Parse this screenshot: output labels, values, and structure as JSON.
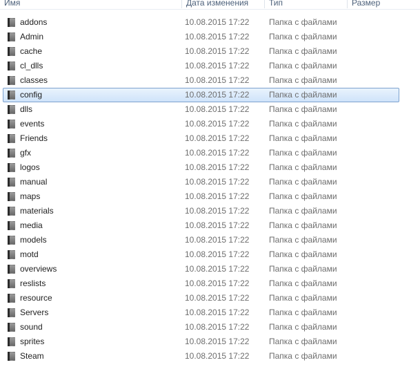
{
  "columns": {
    "name": "Имя",
    "date": "Дата изменения",
    "type": "Тип",
    "size": "Размер"
  },
  "selected_index": 5,
  "files": [
    {
      "name": "addons",
      "date": "10.08.2015 17:22",
      "type": "Папка с файлами"
    },
    {
      "name": "Admin",
      "date": "10.08.2015 17:22",
      "type": "Папка с файлами"
    },
    {
      "name": "cache",
      "date": "10.08.2015 17:22",
      "type": "Папка с файлами"
    },
    {
      "name": "cl_dlls",
      "date": "10.08.2015 17:22",
      "type": "Папка с файлами"
    },
    {
      "name": "classes",
      "date": "10.08.2015 17:22",
      "type": "Папка с файлами"
    },
    {
      "name": "config",
      "date": "10.08.2015 17:22",
      "type": "Папка с файлами"
    },
    {
      "name": "dlls",
      "date": "10.08.2015 17:22",
      "type": "Папка с файлами"
    },
    {
      "name": "events",
      "date": "10.08.2015 17:22",
      "type": "Папка с файлами"
    },
    {
      "name": "Friends",
      "date": "10.08.2015 17:22",
      "type": "Папка с файлами"
    },
    {
      "name": "gfx",
      "date": "10.08.2015 17:22",
      "type": "Папка с файлами"
    },
    {
      "name": "logos",
      "date": "10.08.2015 17:22",
      "type": "Папка с файлами"
    },
    {
      "name": "manual",
      "date": "10.08.2015 17:22",
      "type": "Папка с файлами"
    },
    {
      "name": "maps",
      "date": "10.08.2015 17:22",
      "type": "Папка с файлами"
    },
    {
      "name": "materials",
      "date": "10.08.2015 17:22",
      "type": "Папка с файлами"
    },
    {
      "name": "media",
      "date": "10.08.2015 17:22",
      "type": "Папка с файлами"
    },
    {
      "name": "models",
      "date": "10.08.2015 17:22",
      "type": "Папка с файлами"
    },
    {
      "name": "motd",
      "date": "10.08.2015 17:22",
      "type": "Папка с файлами"
    },
    {
      "name": "overviews",
      "date": "10.08.2015 17:22",
      "type": "Папка с файлами"
    },
    {
      "name": "reslists",
      "date": "10.08.2015 17:22",
      "type": "Папка с файлами"
    },
    {
      "name": "resource",
      "date": "10.08.2015 17:22",
      "type": "Папка с файлами"
    },
    {
      "name": "Servers",
      "date": "10.08.2015 17:22",
      "type": "Папка с файлами"
    },
    {
      "name": "sound",
      "date": "10.08.2015 17:22",
      "type": "Папка с файлами"
    },
    {
      "name": "sprites",
      "date": "10.08.2015 17:22",
      "type": "Папка с файлами"
    },
    {
      "name": "Steam",
      "date": "10.08.2015 17:22",
      "type": "Папка с файлами"
    }
  ]
}
